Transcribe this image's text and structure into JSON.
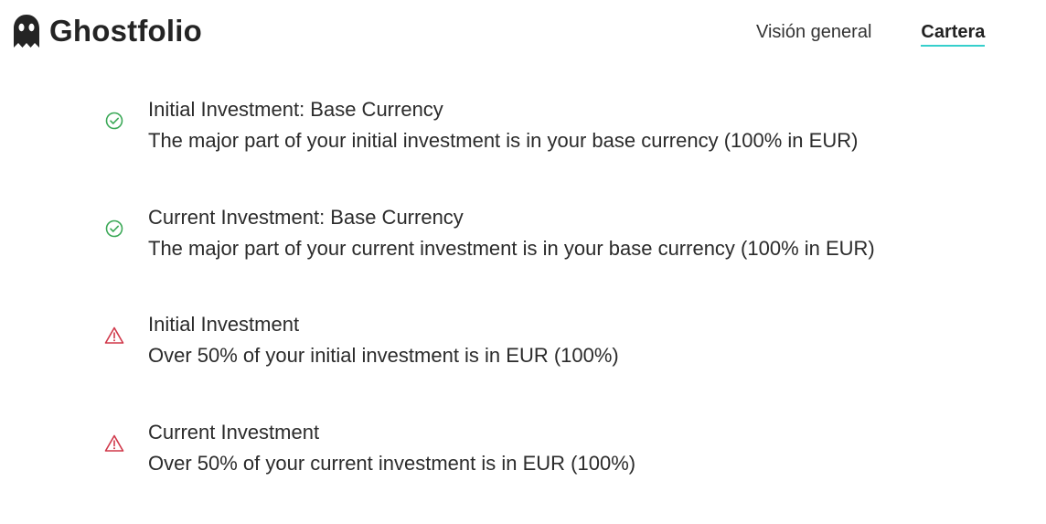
{
  "app": {
    "name": "Ghostfolio",
    "logo_icon": "ghost-icon"
  },
  "nav": {
    "items": [
      {
        "label": "Visión general",
        "active": false
      },
      {
        "label": "Cartera",
        "active": true
      }
    ],
    "active_underline_color": "#36cfcc"
  },
  "rules": [
    {
      "status": "ok",
      "icon": "check-circle-icon",
      "title": "Initial Investment: Base Currency",
      "description": "The major part of your initial investment is in your base currency (100% in EUR)"
    },
    {
      "status": "ok",
      "icon": "check-circle-icon",
      "title": "Current Investment: Base Currency",
      "description": "The major part of your current investment is in your base currency (100% in EUR)"
    },
    {
      "status": "warning",
      "icon": "warning-triangle-icon",
      "title": "Initial Investment",
      "description": "Over 50% of your initial investment is in EUR (100%)"
    },
    {
      "status": "warning",
      "icon": "warning-triangle-icon",
      "title": "Current Investment",
      "description": "Over 50% of your current investment is in EUR (100%)"
    }
  ],
  "colors": {
    "ok": "#3aa856",
    "warning": "#d0384a"
  }
}
